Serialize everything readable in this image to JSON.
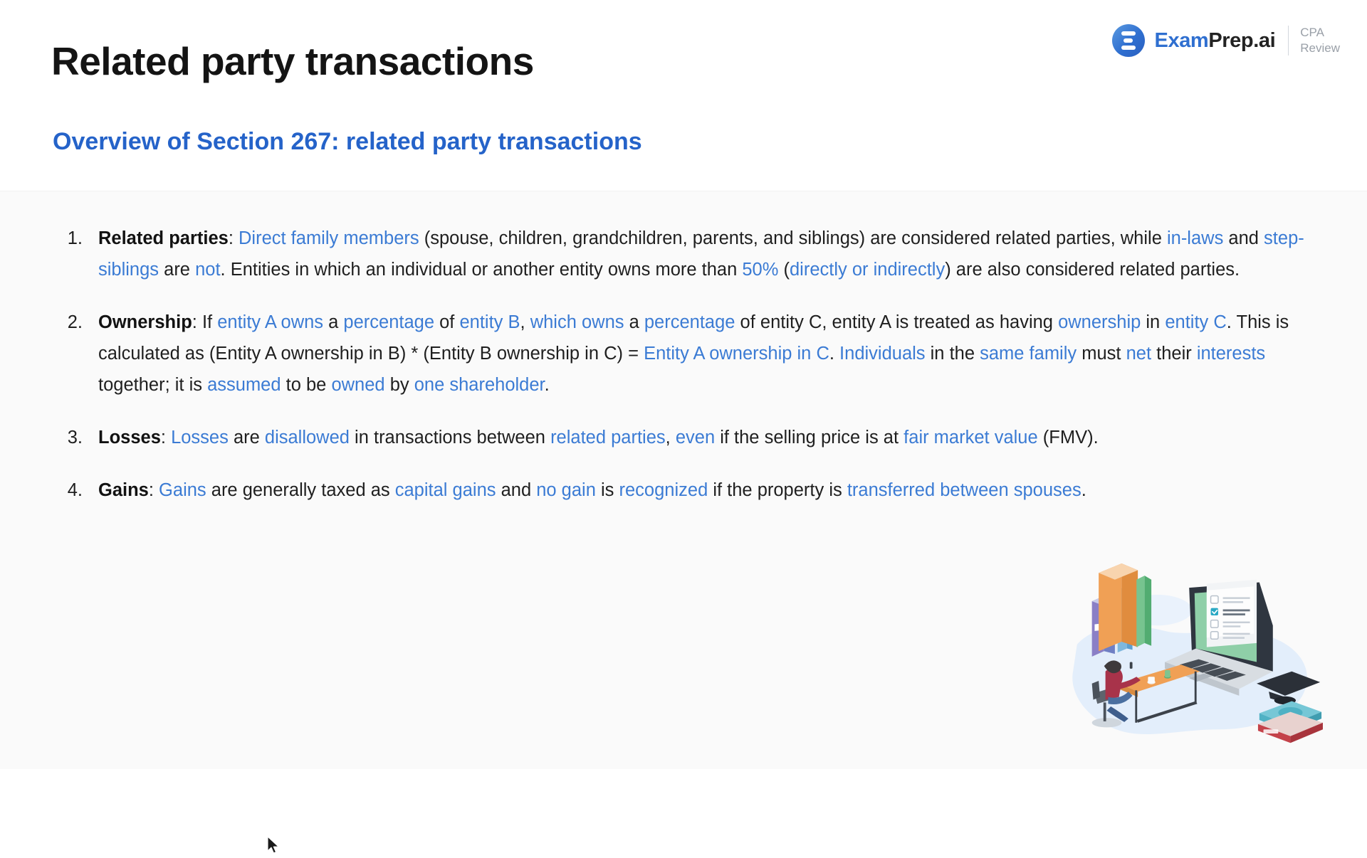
{
  "header": {
    "title": "Related party transactions",
    "section_heading": "Overview of Section 267: related party transactions",
    "brand": {
      "mark_icon": "exam-prep-logo-icon",
      "name_primary": "Exam",
      "name_secondary": "Prep.ai",
      "sub_line1": "CPA",
      "sub_line2": "Review"
    }
  },
  "colors": {
    "accent_blue": "#2563c9",
    "highlight_blue": "#3b7bd4",
    "text_dark": "#1f1f1f",
    "content_bg": "#fafafa",
    "page_bg": "#ffffff"
  },
  "list": [
    {
      "number": "1.",
      "segments": [
        {
          "text": "Related parties",
          "style": "lead"
        },
        {
          "text": ": ",
          "style": "plain"
        },
        {
          "text": "Direct family members",
          "style": "hl"
        },
        {
          "text": " (spouse, children, grandchildren, parents, and siblings) are considered related parties, while ",
          "style": "plain"
        },
        {
          "text": "in-laws",
          "style": "hl"
        },
        {
          "text": " and ",
          "style": "plain"
        },
        {
          "text": "step-siblings",
          "style": "hl"
        },
        {
          "text": " are ",
          "style": "plain"
        },
        {
          "text": "not",
          "style": "hl"
        },
        {
          "text": ". Entities in which an individual or another entity owns more than ",
          "style": "plain"
        },
        {
          "text": "50%",
          "style": "hl"
        },
        {
          "text": " (",
          "style": "plain"
        },
        {
          "text": "directly or indirectly",
          "style": "hl"
        },
        {
          "text": ") are also considered related parties.",
          "style": "plain"
        }
      ]
    },
    {
      "number": "2.",
      "segments": [
        {
          "text": "Ownership",
          "style": "lead"
        },
        {
          "text": ": If ",
          "style": "plain"
        },
        {
          "text": "entity A owns",
          "style": "hl"
        },
        {
          "text": " a ",
          "style": "plain"
        },
        {
          "text": "percentage",
          "style": "hl"
        },
        {
          "text": " of ",
          "style": "plain"
        },
        {
          "text": "entity B",
          "style": "hl"
        },
        {
          "text": ", ",
          "style": "plain"
        },
        {
          "text": "which owns",
          "style": "hl"
        },
        {
          "text": " a ",
          "style": "plain"
        },
        {
          "text": "percentage",
          "style": "hl"
        },
        {
          "text": " of entity C, entity A is treated as having ",
          "style": "plain"
        },
        {
          "text": "ownership",
          "style": "hl"
        },
        {
          "text": " in ",
          "style": "plain"
        },
        {
          "text": "entity C",
          "style": "hl"
        },
        {
          "text": ". This is calculated as (Entity A ownership in B) * (Entity B ownership in C) = ",
          "style": "plain"
        },
        {
          "text": "Entity A ownership in C",
          "style": "hl"
        },
        {
          "text": ". ",
          "style": "plain"
        },
        {
          "text": "Individuals",
          "style": "hl"
        },
        {
          "text": " in the ",
          "style": "plain"
        },
        {
          "text": "same family",
          "style": "hl"
        },
        {
          "text": " must ",
          "style": "plain"
        },
        {
          "text": "net",
          "style": "hl"
        },
        {
          "text": " their ",
          "style": "plain"
        },
        {
          "text": "interests",
          "style": "hl"
        },
        {
          "text": " together; it is ",
          "style": "plain"
        },
        {
          "text": "assumed",
          "style": "hl"
        },
        {
          "text": " to be ",
          "style": "plain"
        },
        {
          "text": "owned",
          "style": "hl"
        },
        {
          "text": " by ",
          "style": "plain"
        },
        {
          "text": "one shareholder",
          "style": "hl"
        },
        {
          "text": ".",
          "style": "plain"
        }
      ]
    },
    {
      "number": "3.",
      "segments": [
        {
          "text": "Losses",
          "style": "lead"
        },
        {
          "text": ": ",
          "style": "plain"
        },
        {
          "text": "Losses",
          "style": "hl"
        },
        {
          "text": " are ",
          "style": "plain"
        },
        {
          "text": "disallowed",
          "style": "hl"
        },
        {
          "text": " in transactions between ",
          "style": "plain"
        },
        {
          "text": "related parties",
          "style": "hl"
        },
        {
          "text": ", ",
          "style": "plain"
        },
        {
          "text": "even",
          "style": "hl"
        },
        {
          "text": " if the selling price is at ",
          "style": "plain"
        },
        {
          "text": "fair market value",
          "style": "hl"
        },
        {
          "text": " (FMV).",
          "style": "plain"
        }
      ]
    },
    {
      "number": "4.",
      "segments": [
        {
          "text": "Gains",
          "style": "lead"
        },
        {
          "text": ": ",
          "style": "plain"
        },
        {
          "text": "Gains",
          "style": "hl"
        },
        {
          "text": " are generally taxed as ",
          "style": "plain"
        },
        {
          "text": "capital gains",
          "style": "hl"
        },
        {
          "text": " and ",
          "style": "plain"
        },
        {
          "text": "no gain",
          "style": "hl"
        },
        {
          "text": " is ",
          "style": "plain"
        },
        {
          "text": "recognized",
          "style": "hl"
        },
        {
          "text": " if the property is ",
          "style": "plain"
        },
        {
          "text": "transferred between spouses",
          "style": "hl"
        },
        {
          "text": ".",
          "style": "plain"
        }
      ]
    }
  ],
  "illustration": {
    "icon": "study-desk-laptop-illustration",
    "alt": "Isometric illustration of books, a laptop showing a checklist, a person studying at a desk, and a graduation cap on books"
  },
  "cursor": {
    "icon": "mouse-pointer-icon"
  }
}
